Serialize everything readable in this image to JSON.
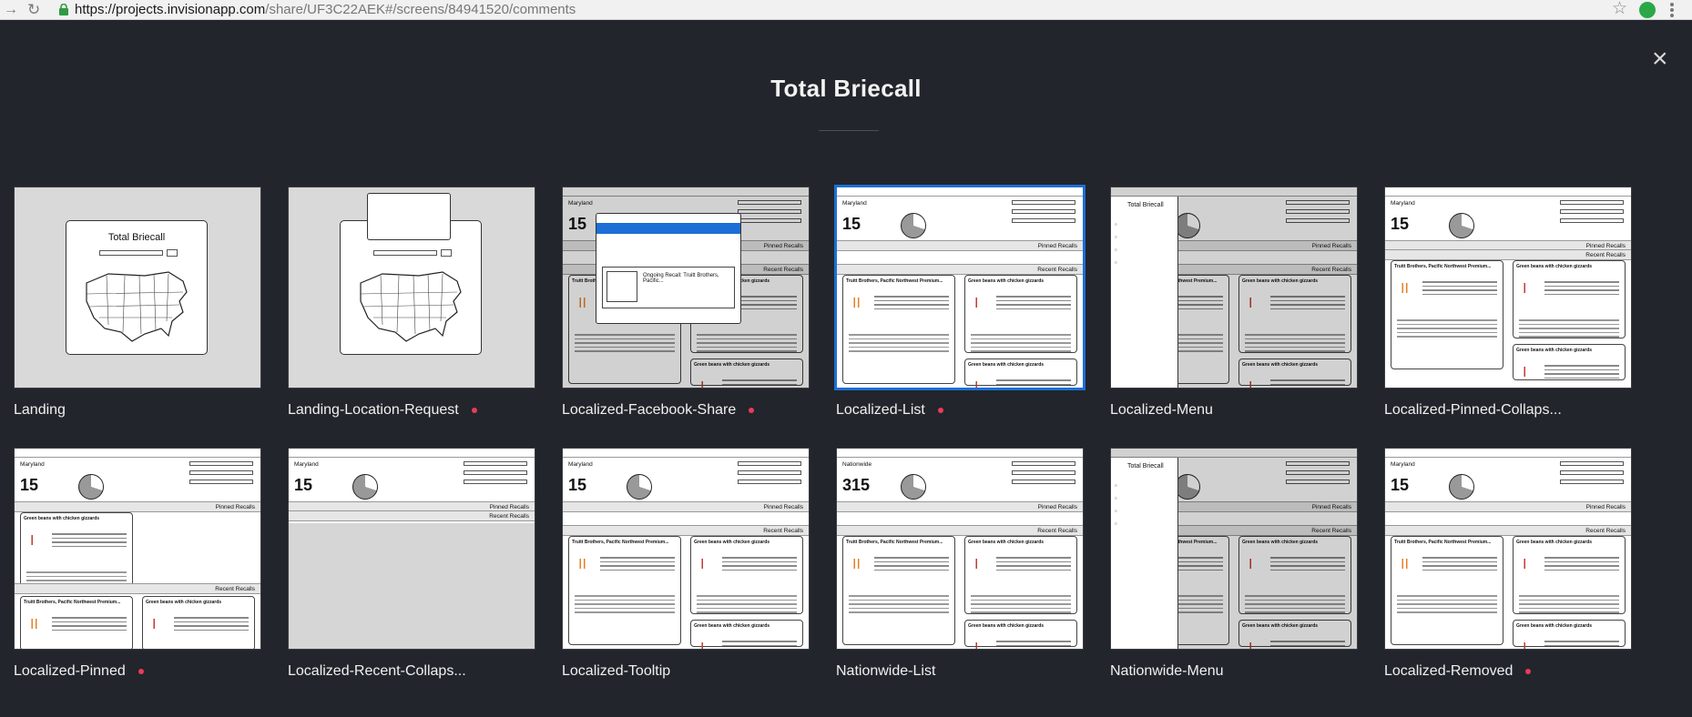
{
  "browser": {
    "url_host": "https://projects.invisionapp.com",
    "url_path": "/share/UF3C22AEK#/screens/84941520/comments"
  },
  "page": {
    "title": "Total Briecall"
  },
  "colors": {
    "background": "#22252b",
    "unread_dot": "#ec3a5a",
    "selected_outline": "#1b6fd6"
  },
  "thumb_text": {
    "app_name": "Total Briecall",
    "location": "Maryland",
    "location_nationwide": "Nationwide",
    "count": "15",
    "count_nationwide": "315",
    "pinned": "Pinned Recalls",
    "recent": "Recent Recalls",
    "card_title_1": "Truitt Brothers, Pacific Northwest Premium...",
    "card_title_2": "Green beans with chicken gizzards",
    "class_roman_2": "II",
    "class_roman_1": "I",
    "fb_title": "Ongoing Recall: Truitt Brothers, Pacific..."
  },
  "screens": [
    {
      "name": "Landing",
      "has_comments": false,
      "selected": false,
      "kind": "landing"
    },
    {
      "name": "Landing-Location-Request",
      "has_comments": true,
      "selected": false,
      "kind": "landing-request"
    },
    {
      "name": "Localized-Facebook-Share",
      "has_comments": true,
      "selected": false,
      "kind": "facebook"
    },
    {
      "name": "Localized-List",
      "has_comments": true,
      "selected": true,
      "kind": "list"
    },
    {
      "name": "Localized-Menu",
      "has_comments": false,
      "selected": false,
      "kind": "menu"
    },
    {
      "name": "Localized-Pinned-Collaps...",
      "has_comments": false,
      "selected": false,
      "kind": "pinned-collapsed"
    },
    {
      "name": "Localized-Pinned",
      "has_comments": true,
      "selected": false,
      "kind": "pinned"
    },
    {
      "name": "Localized-Recent-Collaps...",
      "has_comments": false,
      "selected": false,
      "kind": "recent-collapsed"
    },
    {
      "name": "Localized-Tooltip",
      "has_comments": false,
      "selected": false,
      "kind": "list"
    },
    {
      "name": "Nationwide-List",
      "has_comments": false,
      "selected": false,
      "kind": "nationwide-list"
    },
    {
      "name": "Nationwide-Menu",
      "has_comments": false,
      "selected": false,
      "kind": "menu"
    },
    {
      "name": "Localized-Removed",
      "has_comments": true,
      "selected": false,
      "kind": "removed"
    }
  ]
}
